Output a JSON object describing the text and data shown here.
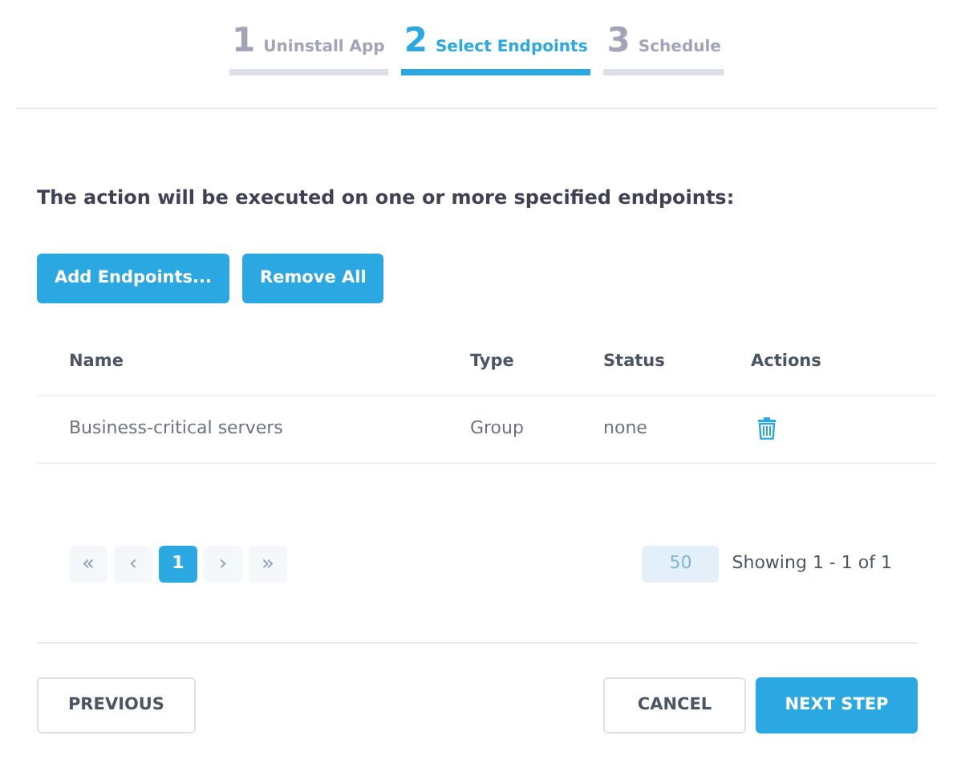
{
  "steps": [
    {
      "number": "1",
      "label": "Uninstall App",
      "selected": false
    },
    {
      "number": "2",
      "label": "Select Endpoints",
      "selected": true
    },
    {
      "number": "3",
      "label": "Schedule",
      "selected": false
    }
  ],
  "instruction": "The action will be executed on one or more specified endpoints:",
  "toolbar": [
    "Add Endpoints...",
    "Remove All"
  ],
  "table": {
    "columns": [
      "Name",
      "Type",
      "Status",
      "Actions"
    ],
    "rows": [
      {
        "name": "Business-critical servers",
        "type": "Group",
        "status": "none"
      }
    ]
  },
  "pagination": {
    "pages": [
      {
        "label": "«",
        "kind": "nav",
        "disabled": true,
        "selected": false
      },
      {
        "label": "‹",
        "kind": "nav",
        "disabled": true,
        "selected": false
      },
      {
        "label": "1",
        "kind": "page",
        "disabled": false,
        "selected": true
      },
      {
        "label": "›",
        "kind": "nav",
        "disabled": true,
        "selected": false
      },
      {
        "label": "»",
        "kind": "nav",
        "disabled": true,
        "selected": false
      }
    ],
    "page_size": "50",
    "summary": "Showing 1 - 1 of 1"
  },
  "footer": {
    "previous": "PREVIOUS",
    "cancel": "CANCEL",
    "next": "NEXT STEP"
  }
}
